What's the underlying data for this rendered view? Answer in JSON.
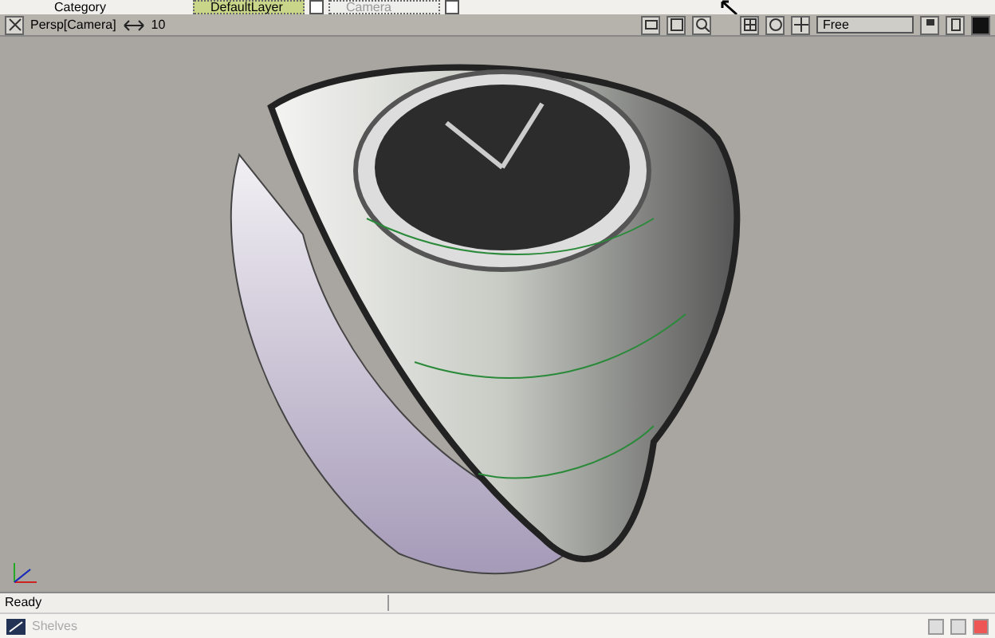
{
  "toolbar": {
    "label": "Category",
    "fields": [
      {
        "value": "DefaultLayer",
        "disabled": false
      },
      {
        "value": "Camera",
        "disabled": true
      }
    ]
  },
  "view_bar": {
    "camera": "Persp[Camera]",
    "step": "10",
    "mode": "Free"
  },
  "status_bar": {
    "text": "Ready"
  },
  "shelf": {
    "title": "Shelves"
  }
}
